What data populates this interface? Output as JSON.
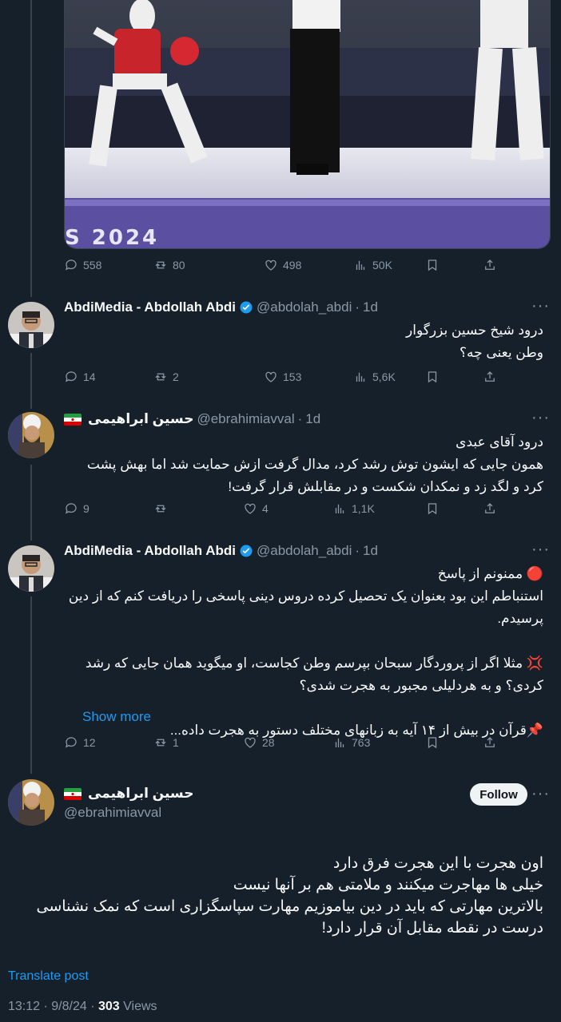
{
  "media_post": {
    "image_caption_text": "S 2024",
    "stats": {
      "replies": "558",
      "reposts": "80",
      "likes": "498",
      "views": "50K"
    }
  },
  "replies": [
    {
      "name": "AbdiMedia - Abdollah Abdi",
      "handle": "@abdolah_abdi",
      "time": "1d",
      "text": "درود شیخ حسین بزرگوار\nوطن یعنی چه؟",
      "stats": {
        "replies": "14",
        "reposts": "2",
        "likes": "153",
        "views": "5,6K"
      }
    },
    {
      "name": "حسین ابراهیمی",
      "handle": "@ebrahimiavval",
      "time": "1d",
      "text": "درود آقای عبدی\nهمون جایی که ایشون توش رشد کرد، مدال گرفت ازش حمایت شد اما بهش پشت کرد و لگد زد و نمکدان شکست و در مقابلش قرار گرفت!",
      "stats": {
        "replies": "9",
        "reposts": "",
        "likes": "4",
        "views": "1,1K"
      }
    },
    {
      "name": "AbdiMedia - Abdollah Abdi",
      "handle": "@abdolah_abdi",
      "time": "1d",
      "text": "🔴 ممنونم از پاسخ\nاستنباطم این بود بعنوان یک تحصیل کرده دروس دینی پاسخی را دریافت کنم که از دین پرسیدم.\n\n💢 مثلا اگر از پروردگار سبحان بپرسم وطن کجاست، او میگوید همان جایی که رشد کردی؟ و به هردلیلی مجبور به هجرت شدی؟\n\n📌قرآن در بیش از ۱۴ آیه به زبانهای مختلف دستور به هجرت داده...",
      "show_more": "Show more",
      "stats": {
        "replies": "12",
        "reposts": "1",
        "likes": "28",
        "views": "763"
      }
    }
  ],
  "main_post": {
    "name": "حسین ابراهیمی",
    "handle": "@ebrahimiavval",
    "follow_label": "Follow",
    "text": "اون هجرت با این هجرت فرق دارد\nخیلی ها مهاجرت میکنند و ملامتی هم بر آنها نیست\nبالاترین مهارتی که باید در دین بیاموزیم مهارت سپاسگزاری است که نمک نشناسی درست در نقطه مقابل آن قرار دارد!",
    "translate_label": "Translate post",
    "time": "13:12",
    "date": "9/8/24",
    "views_count": "303",
    "views_label": "Views"
  },
  "colors": {
    "bg": "#15202b",
    "accent": "#1d9bf0",
    "muted": "#8b98a5",
    "text": "#f7f9f9"
  }
}
